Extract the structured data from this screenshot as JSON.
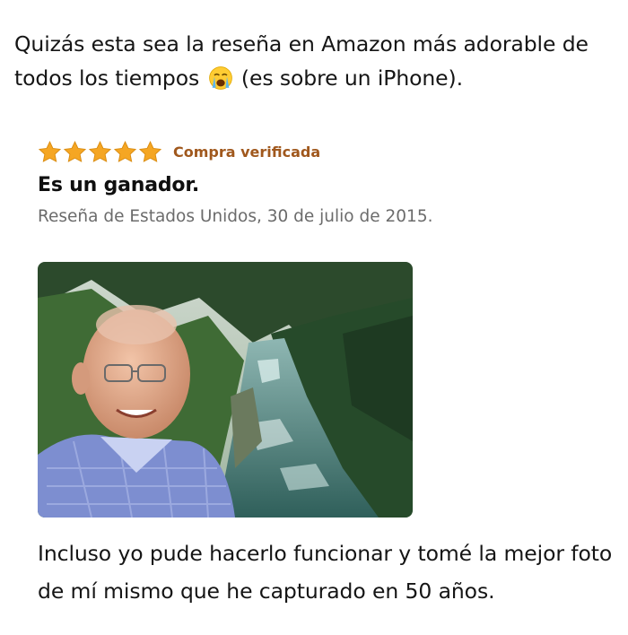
{
  "post": {
    "caption_part1": "Quizás esta sea la reseña en Amazon más adorable de todos los tiempos",
    "caption_emoji": "loudly-crying-face-emoji",
    "caption_part2": "(es sobre un iPhone)."
  },
  "review": {
    "rating": {
      "stars": 5,
      "max": 5
    },
    "verified_label": "Compra verificada",
    "title": "Es un ganador.",
    "meta": "Reseña de Estados Unidos, 30 de julio de 2015.",
    "photo": "selfie-elderly-man-by-river",
    "body": "Incluso yo pude hacerlo funcionar y tomé la mejor foto de mí mismo que he capturado en 50 años."
  },
  "colors": {
    "star": "#f5a623",
    "verified": "#a0581d",
    "meta": "#6b6b6b",
    "text": "#151515"
  }
}
